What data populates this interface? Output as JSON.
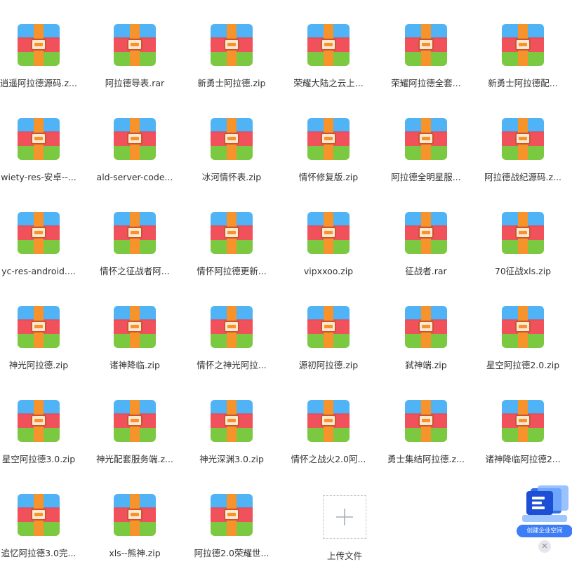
{
  "files": [
    {
      "name": "逍遥阿拉德源码.z..."
    },
    {
      "name": "阿拉德导表.rar"
    },
    {
      "name": "新勇士阿拉德.zip"
    },
    {
      "name": "荣耀大陆之云上..."
    },
    {
      "name": "荣耀阿拉德全套..."
    },
    {
      "name": "新勇士阿拉德配..."
    },
    {
      "name": "wiety-res-安卓--..."
    },
    {
      "name": "ald-server-code..."
    },
    {
      "name": "冰河情怀表.zip"
    },
    {
      "name": "情怀修复版.zip"
    },
    {
      "name": "阿拉德全明星服..."
    },
    {
      "name": "阿拉德战纪源码.z..."
    },
    {
      "name": "yc-res-android...."
    },
    {
      "name": "情怀之征战者阿..."
    },
    {
      "name": "情怀阿拉德更新..."
    },
    {
      "name": "vipxxoo.zip"
    },
    {
      "name": "征战者.rar"
    },
    {
      "name": "70征战xls.zip"
    },
    {
      "name": "神光阿拉德.zip"
    },
    {
      "name": "诸神降临.zip"
    },
    {
      "name": "情怀之神光阿拉..."
    },
    {
      "name": "源初阿拉德.zip"
    },
    {
      "name": "弑神端.zip"
    },
    {
      "name": "星空阿拉德2.0.zip"
    },
    {
      "name": "星空阿拉德3.0.zip"
    },
    {
      "name": "神光配套服务端.z..."
    },
    {
      "name": "神光深渊3.0.zip"
    },
    {
      "name": "情怀之战火2.0阿..."
    },
    {
      "name": "勇士集结阿拉德.z..."
    },
    {
      "name": "诸神降临阿拉德2..."
    },
    {
      "name": "追忆阿拉德3.0完..."
    },
    {
      "name": "xls--熊神.zip"
    },
    {
      "name": "阿拉德2.0荣耀世..."
    }
  ],
  "upload": {
    "label": "上传文件",
    "icon": "plus-icon"
  },
  "promo": {
    "label": "创建企业空间",
    "close": "✕",
    "icon": "enterprise-space-icon"
  },
  "colors": {
    "blue": "#4fb3f5",
    "red": "#f0515b",
    "green": "#7bc940",
    "strap": "#f7932b",
    "accent": "#3d7ef7"
  }
}
